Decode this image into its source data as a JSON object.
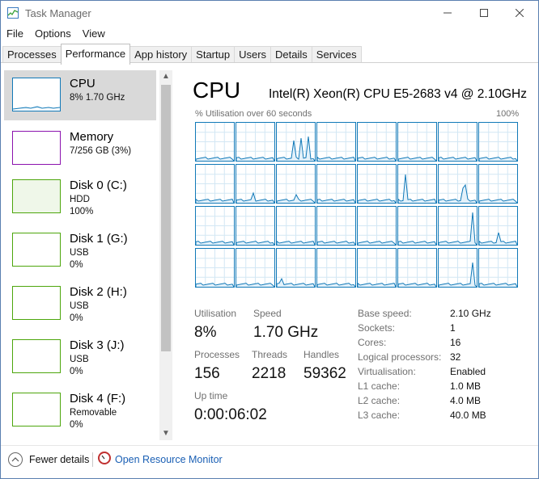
{
  "window": {
    "title": "Task Manager",
    "controls": {
      "minimize_icon": "minimize-icon",
      "maximize_icon": "maximize-icon",
      "close_icon": "close-icon"
    }
  },
  "menu": [
    "File",
    "Options",
    "View"
  ],
  "tabs": [
    {
      "label": "Processes",
      "active": false
    },
    {
      "label": "Performance",
      "active": true
    },
    {
      "label": "App history",
      "active": false
    },
    {
      "label": "Startup",
      "active": false
    },
    {
      "label": "Users",
      "active": false
    },
    {
      "label": "Details",
      "active": false
    },
    {
      "label": "Services",
      "active": false
    }
  ],
  "sidebar": {
    "items": [
      {
        "name": "CPU",
        "line1": "8% 1.70 GHz",
        "line2": "",
        "color": "#1179b8",
        "selected": true
      },
      {
        "name": "Memory",
        "line1": "7/256 GB (3%)",
        "line2": "",
        "color": "#8b12ae",
        "selected": false
      },
      {
        "name": "Disk 0 (C:)",
        "line1": "HDD",
        "line2": "100%",
        "color": "#4da60c",
        "selected": false
      },
      {
        "name": "Disk 1 (G:)",
        "line1": "USB",
        "line2": "0%",
        "color": "#4da60c",
        "selected": false
      },
      {
        "name": "Disk 2 (H:)",
        "line1": "USB",
        "line2": "0%",
        "color": "#4da60c",
        "selected": false
      },
      {
        "name": "Disk 3 (J:)",
        "line1": "USB",
        "line2": "0%",
        "color": "#4da60c",
        "selected": false
      },
      {
        "name": "Disk 4 (F:)",
        "line1": "Removable",
        "line2": "0%",
        "color": "#4da60c",
        "selected": false
      }
    ]
  },
  "cpu": {
    "title": "CPU",
    "model": "Intel(R) Xeon(R) CPU E5-2683 v4 @ 2.10GHz",
    "graph_caption": "% Utilisation over 60 seconds",
    "graph_max": "100%",
    "logical_processor_graphs": 32,
    "stats": {
      "utilisation_label": "Utilisation",
      "utilisation": "8%",
      "speed_label": "Speed",
      "speed": "1.70 GHz",
      "processes_label": "Processes",
      "processes": "156",
      "threads_label": "Threads",
      "threads": "2218",
      "handles_label": "Handles",
      "handles": "59362",
      "uptime_label": "Up time",
      "uptime": "0:00:06:02"
    },
    "details": [
      {
        "label": "Base speed:",
        "value": "2.10 GHz"
      },
      {
        "label": "Sockets:",
        "value": "1"
      },
      {
        "label": "Cores:",
        "value": "16"
      },
      {
        "label": "Logical processors:",
        "value": "32"
      },
      {
        "label": "Virtualisation:",
        "value": "Enabled"
      },
      {
        "label": "L1 cache:",
        "value": "1.0 MB"
      },
      {
        "label": "L2 cache:",
        "value": "4.0 MB"
      },
      {
        "label": "L3 cache:",
        "value": "40.0 MB"
      }
    ]
  },
  "footer": {
    "fewer_details": "Fewer details",
    "resource_monitor": "Open Resource Monitor"
  },
  "colors": {
    "cpu_line": "#1179b8",
    "grid": "#d3e7f4",
    "link": "#1a5fb4"
  }
}
